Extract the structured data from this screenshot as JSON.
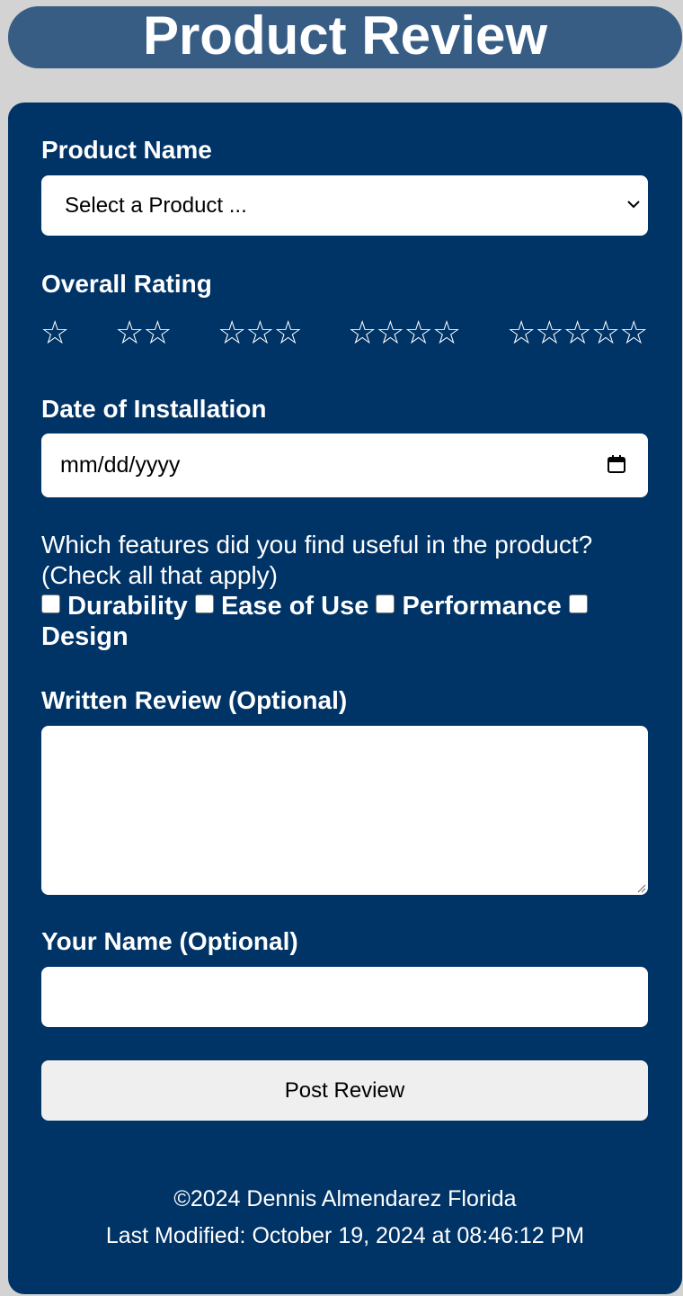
{
  "header": {
    "title": "Product Review"
  },
  "form": {
    "product_label": "Product Name",
    "product_select_value": "Select a Product ...",
    "rating_label": "Overall Rating",
    "rating_options": [
      "☆",
      "☆☆",
      "☆☆☆",
      "☆☆☆☆",
      "☆☆☆☆☆"
    ],
    "date_label": "Date of Installation",
    "date_placeholder": "mm/dd/yyyy",
    "features_question": "Which features did you find useful in the product? (Check all that apply)",
    "features": [
      "Durability",
      "Ease of Use",
      "Performance",
      "Design"
    ],
    "review_label": "Written Review (Optional)",
    "review_value": "",
    "name_label": "Your Name (Optional)",
    "name_value": "",
    "submit_label": "Post Review"
  },
  "footer": {
    "copyright": "©2024 Dennis Almendarez Florida",
    "last_modified": "Last Modified: October 19, 2024 at 08:46:12 PM"
  },
  "colors": {
    "page_background": "#d3d3d3",
    "header_background": "#375d85",
    "card_background": "#003366",
    "field_background": "#ffffff",
    "button_background": "#efefef"
  },
  "icons": {
    "select": "chevron-down-icon",
    "date": "calendar-icon",
    "rating": "star-icon",
    "textarea": "resize-grip-icon"
  }
}
